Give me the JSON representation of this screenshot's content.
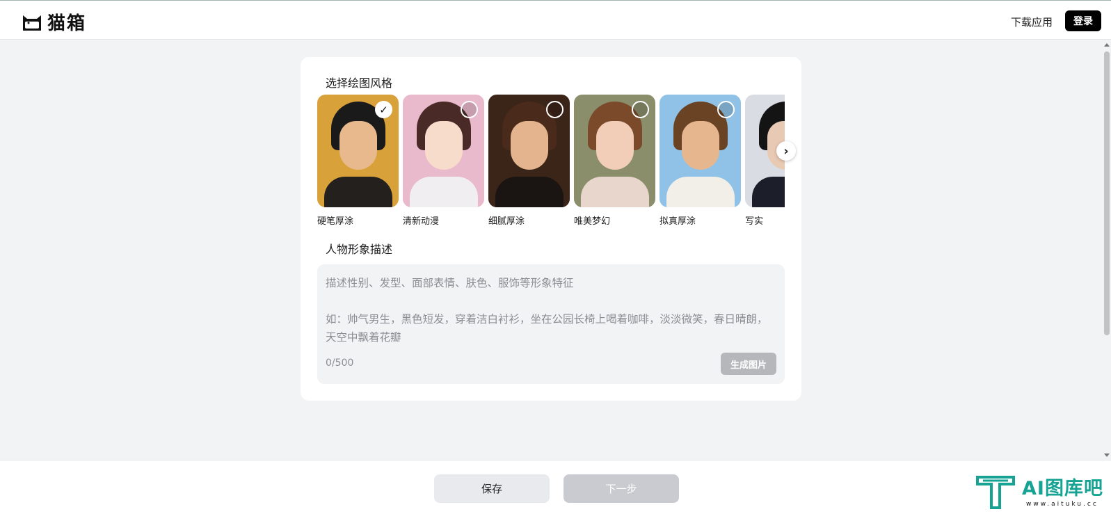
{
  "header": {
    "logo_text": "猫箱",
    "download_link": "下载应用",
    "login_button": "登录"
  },
  "style_section": {
    "title": "选择绘图风格",
    "items": [
      {
        "label": "硬笔厚涂",
        "selected": true,
        "bg": "#d8a13a",
        "hair": "#1b1a1a",
        "skin": "#e7b98c",
        "cloth": "#23201d"
      },
      {
        "label": "清新动漫",
        "selected": false,
        "bg": "#e9b9cc",
        "hair": "#4a2a26",
        "skin": "#f7dccb",
        "cloth": "#f1eef2"
      },
      {
        "label": "细腻厚涂",
        "selected": false,
        "bg": "#3b2418",
        "hair": "#4a2a1a",
        "skin": "#e3b48d",
        "cloth": "#1a1412"
      },
      {
        "label": "唯美梦幻",
        "selected": false,
        "bg": "#8a8e6a",
        "hair": "#7a4a2a",
        "skin": "#f2cdb8",
        "cloth": "#e8d6cc"
      },
      {
        "label": "拟真厚涂",
        "selected": false,
        "bg": "#8fc2e6",
        "hair": "#6a4224",
        "skin": "#e6b78f",
        "cloth": "#f2efe9"
      },
      {
        "label": "写实",
        "selected": false,
        "bg": "#d9dde3",
        "hair": "#141414",
        "skin": "#e8c9b3",
        "cloth": "#1c1f2a"
      }
    ]
  },
  "description_section": {
    "title": "人物形象描述",
    "placeholder": "描述性别、发型、面部表情、肤色、服饰等形象特征\n\n如：帅气男生，黑色短发，穿着洁白衬衫，坐在公园长椅上喝着咖啡，淡淡微笑，春日晴朗，天空中飘着花瓣",
    "counter": "0/500",
    "generate_button": "生成图片"
  },
  "footer": {
    "save_button": "保存",
    "next_button": "下一步"
  },
  "watermark": {
    "title": "AI图库吧",
    "url": "www.aituku.cc"
  },
  "icons": {
    "logo": "cat-box-icon",
    "check": "check-icon",
    "next": "chevron-right-icon"
  },
  "colors": {
    "accent_black": "#000000",
    "page_bg": "#f2f3f5",
    "watermark_teal": "#16a394"
  }
}
